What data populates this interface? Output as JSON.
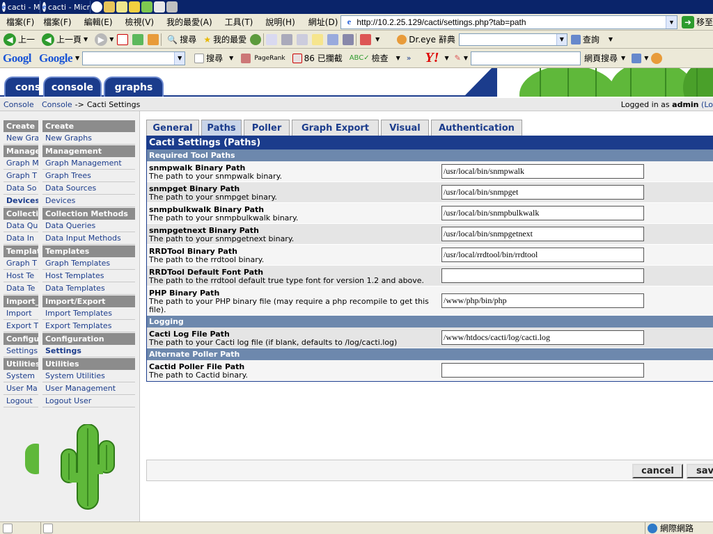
{
  "taskbar": {
    "items": [
      {
        "label": "cacti - M"
      },
      {
        "label": "cacti - Micr"
      }
    ],
    "tray_icons": [
      "ie-icon",
      "folder-icon",
      "note-icon",
      "pen-icon",
      "bell-icon",
      "doc-icon",
      "brush-icon"
    ]
  },
  "menubar": {
    "items": [
      "檔案(F)",
      "編輯(E)",
      "檢視(V)",
      "我的最愛(A)",
      "工具(T)",
      "說明(H)"
    ],
    "bg_items": [
      "檔案(F)"
    ],
    "address_label": "網址(D)",
    "address_url": "http://10.2.25.129/cacti/settings.php?tab=path",
    "go_label": "移至"
  },
  "toolbar": {
    "bg_back": "上一",
    "back": "上一頁",
    "search": "搜尋",
    "favorites": "我的最愛",
    "dreye": "Dr.eye 辭典",
    "query": "查詢"
  },
  "googlebar": {
    "bg_logo": "Googl",
    "logo": "Google",
    "search": "搜尋",
    "pagerank": "PageRank",
    "blocked": "86 已攔截",
    "check": "檢查",
    "more": "»",
    "yahoo": "Y!",
    "web_search": "網頁搜尋"
  },
  "bg_window": {
    "tab_label": "cons",
    "breadcrumb": "Console",
    "menu": [
      {
        "type": "header",
        "label": "Create"
      },
      {
        "type": "item",
        "label": "New Gra"
      },
      {
        "type": "header",
        "label": "Manage"
      },
      {
        "type": "item",
        "label": "Graph M"
      },
      {
        "type": "item",
        "label": "Graph T"
      },
      {
        "type": "item",
        "label": "Data So"
      },
      {
        "type": "item",
        "label": "Devices",
        "selected": true
      },
      {
        "type": "header",
        "label": "Collecti"
      },
      {
        "type": "item",
        "label": "Data Qu"
      },
      {
        "type": "item",
        "label": "Data In"
      },
      {
        "type": "header",
        "label": "Templat"
      },
      {
        "type": "item",
        "label": "Graph T"
      },
      {
        "type": "item",
        "label": "Host Te"
      },
      {
        "type": "item",
        "label": "Data Te"
      },
      {
        "type": "header",
        "label": "Import_"
      },
      {
        "type": "item",
        "label": "Import"
      },
      {
        "type": "item",
        "label": "Export T"
      },
      {
        "type": "header",
        "label": "Configur"
      },
      {
        "type": "item",
        "label": "Settings"
      },
      {
        "type": "header",
        "label": "Utilities"
      },
      {
        "type": "item",
        "label": "System"
      },
      {
        "type": "item",
        "label": "User Ma"
      },
      {
        "type": "item",
        "label": "Logout"
      }
    ]
  },
  "header": {
    "tab_console": "console",
    "tab_graphs": "graphs"
  },
  "breadcrumb": {
    "root": "Console",
    "sep": "->",
    "current": "Cacti Settings",
    "logged_in_prefix": "Logged in as",
    "user": "admin",
    "logout_link": "(Lo"
  },
  "sidebar": {
    "groups": [
      {
        "header": "Create",
        "items": [
          {
            "label": "New Graphs"
          }
        ]
      },
      {
        "header": "Management",
        "items": [
          {
            "label": "Graph Management"
          },
          {
            "label": "Graph Trees"
          },
          {
            "label": "Data Sources"
          },
          {
            "label": "Devices"
          }
        ]
      },
      {
        "header": "Collection Methods",
        "items": [
          {
            "label": "Data Queries"
          },
          {
            "label": "Data Input Methods"
          }
        ]
      },
      {
        "header": "Templates",
        "items": [
          {
            "label": "Graph Templates"
          },
          {
            "label": "Host Templates"
          },
          {
            "label": "Data Templates"
          }
        ]
      },
      {
        "header": "Import/Export",
        "items": [
          {
            "label": "Import Templates"
          },
          {
            "label": "Export Templates"
          }
        ]
      },
      {
        "header": "Configuration",
        "items": [
          {
            "label": "Settings",
            "selected": true
          }
        ]
      },
      {
        "header": "Utilities",
        "items": [
          {
            "label": "System Utilities"
          },
          {
            "label": "User Management"
          },
          {
            "label": "Logout User"
          }
        ]
      }
    ]
  },
  "settings_tabs": [
    "General",
    "Paths",
    "Poller",
    "Graph Export",
    "Visual",
    "Authentication"
  ],
  "active_tab": "Paths",
  "settings": {
    "title": "Cacti Settings (Paths)",
    "sections": [
      {
        "title": "Required Tool Paths",
        "rows": [
          {
            "name": "snmpwalk Binary Path",
            "desc": "The path to your snmpwalk binary.",
            "value": "/usr/local/bin/snmpwalk"
          },
          {
            "name": "snmpget Binary Path",
            "desc": "The path to your snmpget binary.",
            "value": "/usr/local/bin/snmpget"
          },
          {
            "name": "snmpbulkwalk Binary Path",
            "desc": "The path to your snmpbulkwalk binary.",
            "value": "/usr/local/bin/snmpbulkwalk"
          },
          {
            "name": "snmpgetnext Binary Path",
            "desc": "The path to your snmpgetnext binary.",
            "value": "/usr/local/bin/snmpgetnext"
          },
          {
            "name": "RRDTool Binary Path",
            "desc": "The path to the rrdtool binary.",
            "value": "/usr/local/rrdtool/bin/rrdtool"
          },
          {
            "name": "RRDTool Default Font Path",
            "desc": "The path to the rrdtool default true type font for version 1.2 and above.",
            "value": ""
          },
          {
            "name": "PHP Binary Path",
            "desc": "The path to your PHP binary file (may require a php recompile to get this file).",
            "value": "/www/php/bin/php",
            "tall": true
          }
        ]
      },
      {
        "title": "Logging",
        "rows": [
          {
            "name": "Cacti Log File Path",
            "desc": "The path to your Cacti log file (if blank, defaults to /log/cacti.log)",
            "value": "/www/htdocs/cacti/log/cacti.log"
          }
        ]
      },
      {
        "title": "Alternate Poller Path",
        "rows": [
          {
            "name": "Cactid Poller File Path",
            "desc": "The path to Cactid binary.",
            "value": ""
          }
        ]
      }
    ]
  },
  "buttons": {
    "cancel": "cancel",
    "save": "sav"
  },
  "statusbar": {
    "zone": "網際網路"
  },
  "colors": {
    "accent": "#1b3c8c",
    "section": "#6d88ad",
    "menu_header": "#8c8c8c"
  }
}
